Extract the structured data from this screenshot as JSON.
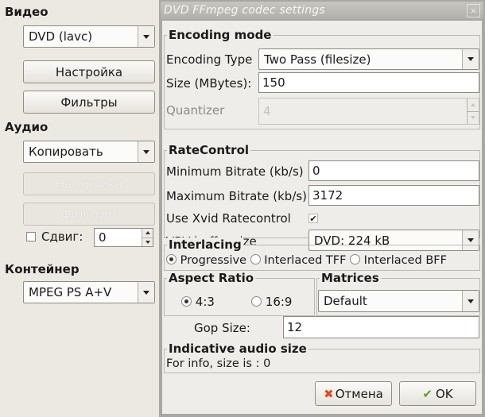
{
  "left": {
    "video": {
      "header": "Видео",
      "codec": "DVD (lavc)",
      "configure": "Настройка",
      "filters": "Фильтры"
    },
    "audio": {
      "header": "Аудио",
      "codec": "Копировать",
      "configure": "Настройка",
      "filters": "Фильтры",
      "shift_label": "Сдвиг:",
      "shift_value": "0",
      "shift_checked": false
    },
    "container": {
      "header": "Контейнер",
      "format": "MPEG PS A+V"
    }
  },
  "dialog": {
    "title": "DVD FFmpeg codec settings",
    "close_glyph": "×",
    "encoding_mode": {
      "title": "Encoding mode",
      "type_label": "Encoding Type",
      "type_value": "Two Pass (filesize)",
      "size_label": "Size (MBytes):",
      "size_value": "150",
      "quantizer_label": "Quantizer",
      "quantizer_value": "4"
    },
    "rate_control": {
      "title": "RateControl",
      "min_label": "Minimum Bitrate (kb/s)",
      "min_value": "0",
      "max_label": "Maximum Bitrate (kb/s)",
      "max_value": "3172",
      "xvid_label": "Use Xvid Ratecontrol",
      "xvid_checked": true,
      "vbv_label": "VBV buffer size",
      "vbv_value": "DVD: 224 kB"
    },
    "interlacing": {
      "title": "Interlacing",
      "options": [
        "Progressive",
        "Interlaced TFF",
        "Interlaced BFF"
      ],
      "selected": "Progressive"
    },
    "aspect_ratio": {
      "title": "Aspect Ratio",
      "options": [
        "4:3",
        "16:9"
      ],
      "selected": "4:3"
    },
    "matrices": {
      "title": "Matrices",
      "value": "Default"
    },
    "gop": {
      "label": "Gop Size:",
      "value": "12"
    },
    "audio_size": {
      "title": "Indicative audio size",
      "info": "For info, size is : 0"
    },
    "buttons": {
      "cancel": "Отмена",
      "ok": "OK"
    },
    "colors": {
      "cancel_icon": "#e24a1c",
      "ok_icon": "#5aa61e"
    }
  }
}
